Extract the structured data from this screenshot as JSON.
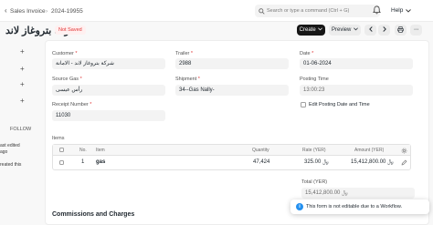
{
  "topbar": {
    "breadcrumb_1": "Sales Invoice",
    "separator": "›",
    "breadcrumb_2": "2024-19955",
    "search_placeholder": "Search or type a command (Ctrl + G)",
    "help_label": "Help"
  },
  "header": {
    "title": "شركة بتروغاز لاند",
    "status": "Not Saved",
    "create_label": "Create",
    "preview_label": "Preview"
  },
  "sidebar": {
    "follow_label": "FOLLOW",
    "line_1": "ast edited",
    "line_2": "ago",
    "line_3": "reated this"
  },
  "form": {
    "customer_label": "Customer",
    "customer_value": "شركة بتروغاز لاند - الامانة",
    "trailer_label": "Trailer",
    "trailer_value": "2988",
    "date_label": "Date",
    "date_value": "01-06-2024",
    "source_gas_label": "Source Gas",
    "source_gas_value": "رأس عيسى",
    "shipment_label": "Shipment",
    "shipment_value": "34--Gas Nally-",
    "posting_time_label": "Posting Time",
    "posting_time_value": "13:00:23",
    "edit_posting_label": "Edit Posting Date and Time",
    "receipt_label": "Receipt Number",
    "receipt_value": "11030",
    "required_mark": "*"
  },
  "items": {
    "section_label": "Items",
    "columns": [
      "No.",
      "Item",
      "Quantity",
      "Rate (YER)",
      "Amount (YER)"
    ],
    "rows": [
      {
        "no": "1",
        "item": "gas",
        "quantity": "47,424",
        "rate": "325.00 ﷼",
        "amount": "15,412,800.00 ﷼"
      }
    ]
  },
  "totals": {
    "total_label": "Total (YER)",
    "total_value": "15,412,800.00 ﷼"
  },
  "section_commissions": "Commissions and Charges",
  "toast": {
    "info_glyph": "i",
    "message": "This form is not editable due to a Workflow."
  }
}
